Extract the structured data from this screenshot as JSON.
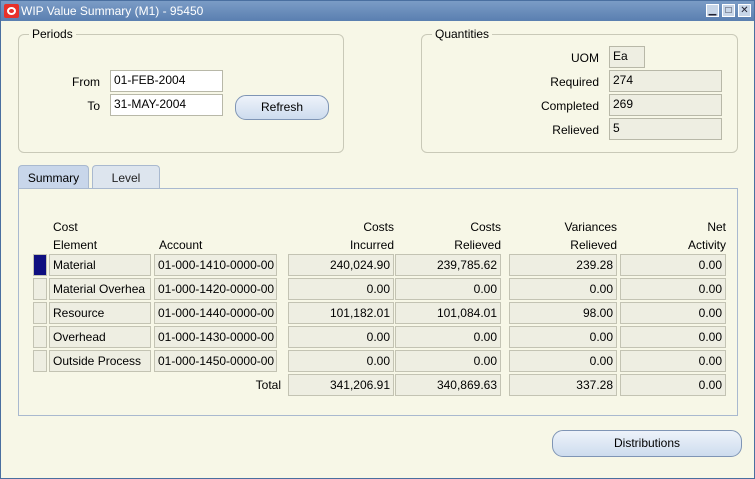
{
  "window": {
    "title": "WIP Value Summary (M1) - 95450",
    "controls": [
      "▁",
      "□",
      "✕"
    ]
  },
  "periods": {
    "legend": "Periods",
    "from_label": "From",
    "from_value": "01-FEB-2004",
    "to_label": "To",
    "to_value": "31-MAY-2004",
    "refresh_label": "Refresh"
  },
  "quantities": {
    "legend": "Quantities",
    "uom_label": "UOM",
    "uom_value": "Ea",
    "required_label": "Required",
    "required_value": "274",
    "completed_label": "Completed",
    "completed_value": "269",
    "relieved_label": "Relieved",
    "relieved_value": "5"
  },
  "tabs": [
    {
      "label": "Summary",
      "active": true
    },
    {
      "label": "Level",
      "active": false
    }
  ],
  "table": {
    "headers": {
      "cost_element_1": "Cost",
      "cost_element_2": "Element",
      "account": "Account",
      "incurred_1": "Costs",
      "incurred_2": "Incurred",
      "relieved_1": "Costs",
      "relieved_2": "Relieved",
      "variances_1": "Variances",
      "variances_2": "Relieved",
      "net_1": "Net",
      "net_2": "Activity"
    },
    "rows": [
      {
        "element": "Material",
        "account": "01-000-1410-0000-00",
        "incurred": "240,024.90",
        "relieved": "239,785.62",
        "variances": "239.28",
        "net": "0.00"
      },
      {
        "element": "Material Overhea",
        "account": "01-000-1420-0000-00",
        "incurred": "0.00",
        "relieved": "0.00",
        "variances": "0.00",
        "net": "0.00"
      },
      {
        "element": "Resource",
        "account": "01-000-1440-0000-00",
        "incurred": "101,182.01",
        "relieved": "101,084.01",
        "variances": "98.00",
        "net": "0.00"
      },
      {
        "element": "Overhead",
        "account": "01-000-1430-0000-00",
        "incurred": "0.00",
        "relieved": "0.00",
        "variances": "0.00",
        "net": "0.00"
      },
      {
        "element": "Outside Process",
        "account": "01-000-1450-0000-00",
        "incurred": "0.00",
        "relieved": "0.00",
        "variances": "0.00",
        "net": "0.00"
      }
    ],
    "total": {
      "label": "Total",
      "incurred": "341,206.91",
      "relieved": "340,869.63",
      "variances": "337.28",
      "net": "0.00"
    }
  },
  "distributions_label": "Distributions"
}
